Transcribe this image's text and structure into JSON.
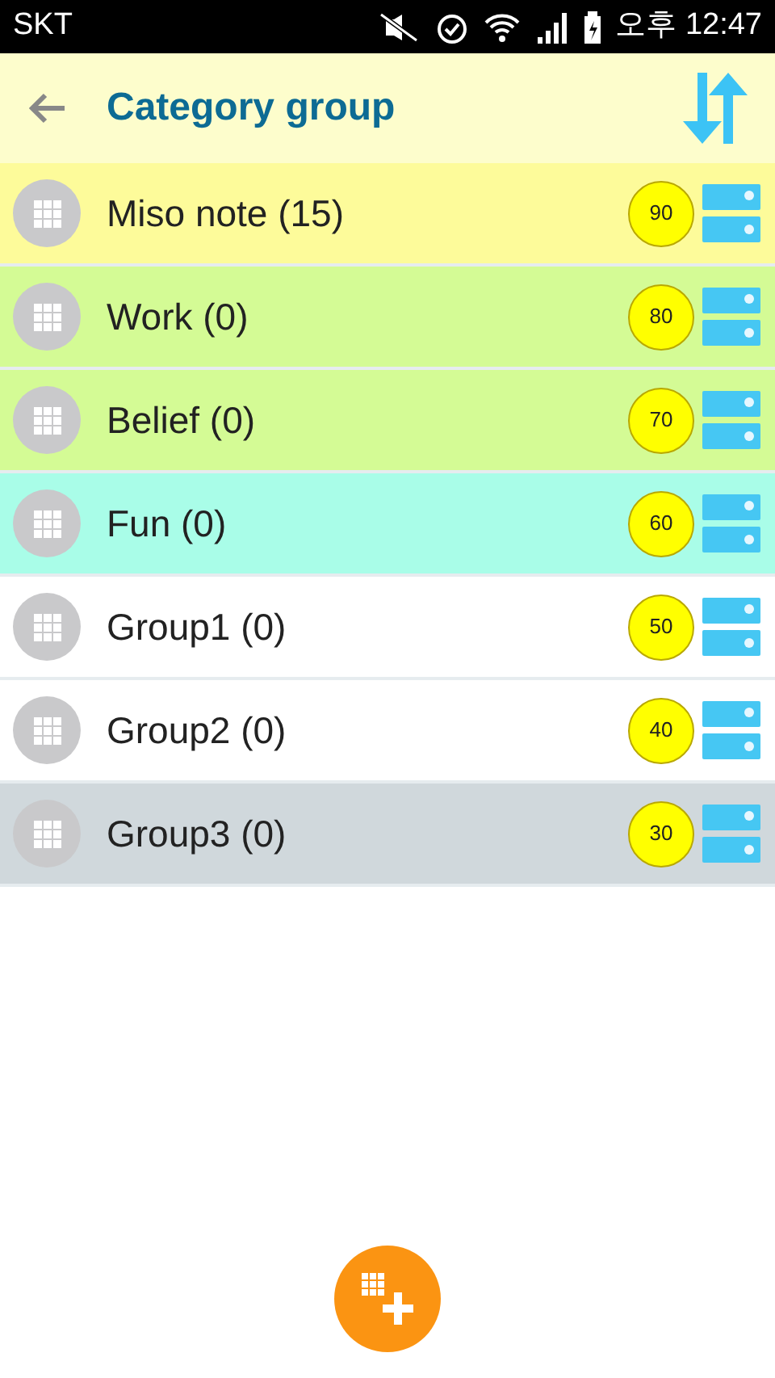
{
  "status_bar": {
    "carrier": "SKT",
    "time": "오후 12:47"
  },
  "toolbar": {
    "title": "Category group"
  },
  "groups": [
    {
      "name": "Miso note (15)",
      "order": "90",
      "color": "#fdfb9a"
    },
    {
      "name": "Work (0)",
      "order": "80",
      "color": "#d4fb95"
    },
    {
      "name": "Belief (0)",
      "order": "70",
      "color": "#d4fb95"
    },
    {
      "name": "Fun (0)",
      "order": "60",
      "color": "#a9fde8"
    },
    {
      "name": "Group1 (0)",
      "order": "50",
      "color": "#ffffff"
    },
    {
      "name": "Group2 (0)",
      "order": "40",
      "color": "#ffffff"
    },
    {
      "name": "Group3 (0)",
      "order": "30",
      "color": "#d0d8dc"
    }
  ]
}
